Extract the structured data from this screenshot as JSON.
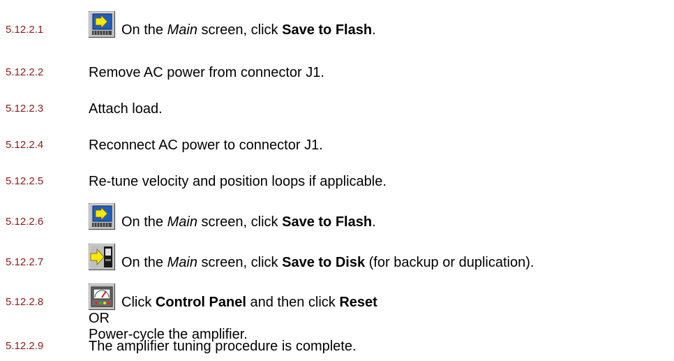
{
  "steps": [
    {
      "number": "5.12.2.1",
      "icon": "save-to-flash-icon",
      "parts": [
        {
          "text": "On the ",
          "style": "normal"
        },
        {
          "text": "Main",
          "style": "italic"
        },
        {
          "text": " screen, click ",
          "style": "normal"
        },
        {
          "text": "Save to Flash",
          "style": "bold"
        },
        {
          "text": ".",
          "style": "normal"
        }
      ]
    },
    {
      "number": "5.12.2.2",
      "parts": [
        {
          "text": "Remove AC power from connector J1.",
          "style": "normal"
        }
      ]
    },
    {
      "number": "5.12.2.3",
      "parts": [
        {
          "text": "Attach load.",
          "style": "normal"
        }
      ]
    },
    {
      "number": "5.12.2.4",
      "parts": [
        {
          "text": "Reconnect AC power to connector J1.",
          "style": "normal"
        }
      ]
    },
    {
      "number": "5.12.2.5",
      "parts": [
        {
          "text": "Re-tune velocity and position loops if applicable.",
          "style": "normal"
        }
      ]
    },
    {
      "number": "5.12.2.6",
      "icon": "save-to-flash-icon",
      "parts": [
        {
          "text": "On the ",
          "style": "normal"
        },
        {
          "text": "Main",
          "style": "italic"
        },
        {
          "text": " screen, click ",
          "style": "normal"
        },
        {
          "text": "Save to Flash",
          "style": "bold"
        },
        {
          "text": ".",
          "style": "normal"
        }
      ]
    },
    {
      "number": "5.12.2.7",
      "icon": "save-to-disk-icon",
      "parts": [
        {
          "text": "On the ",
          "style": "normal"
        },
        {
          "text": "Main",
          "style": "italic"
        },
        {
          "text": " screen, click ",
          "style": "normal"
        },
        {
          "text": "Save to Disk",
          "style": "bold"
        },
        {
          "text": " (for backup or duplication).",
          "style": "normal"
        }
      ]
    },
    {
      "number": "5.12.2.8",
      "icon": "control-panel-icon",
      "parts": [
        {
          "text": "Click ",
          "style": "normal"
        },
        {
          "text": "Control Panel",
          "style": "bold"
        },
        {
          "text": " and then click ",
          "style": "normal"
        },
        {
          "text": "Reset",
          "style": "bold"
        }
      ],
      "extra_lines": [
        "OR",
        "Power-cycle the amplifier."
      ]
    },
    {
      "number": "5.12.2.9",
      "parts": [
        {
          "text": "The amplifier tuning procedure is complete.",
          "style": "normal"
        }
      ]
    }
  ]
}
